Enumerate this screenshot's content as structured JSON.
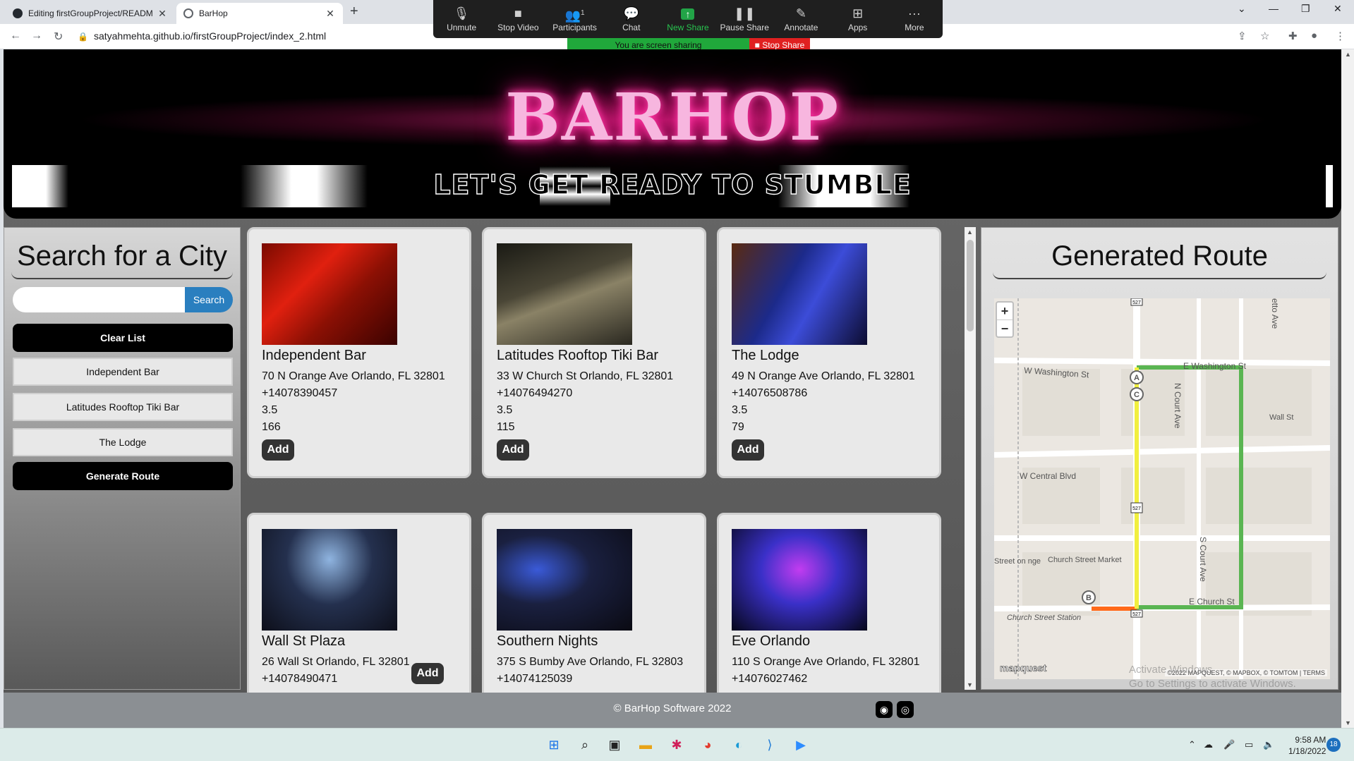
{
  "browser": {
    "tabs": [
      {
        "title": "Editing firstGroupProject/READM",
        "active": false
      },
      {
        "title": "BarHop",
        "active": true
      }
    ],
    "new_tab": "+",
    "url": "satyahmehta.github.io/firstGroupProject/index_2.html"
  },
  "zoom": {
    "buttons": [
      {
        "label": "Unmute",
        "icon": "mic-off-icon"
      },
      {
        "label": "Stop Video",
        "icon": "video-camera-icon"
      },
      {
        "label": "Participants",
        "icon": "participants-icon",
        "count": "1"
      },
      {
        "label": "Chat",
        "icon": "chat-icon"
      },
      {
        "label": "New Share",
        "icon": "share-arrow-icon"
      },
      {
        "label": "Pause Share",
        "icon": "pause-icon"
      },
      {
        "label": "Annotate",
        "icon": "pencil-icon"
      },
      {
        "label": "Apps",
        "icon": "apps-icon"
      },
      {
        "label": "More",
        "icon": "ellipsis-icon"
      }
    ],
    "sharing_text": "You are screen sharing",
    "stop_share": "Stop Share"
  },
  "hero": {
    "brand": "BARHOP",
    "tagline": "LET'S GET READY TO STUMBLE"
  },
  "sidebar": {
    "title": "Search for a City",
    "search_placeholder": "",
    "search_button": "Search",
    "clear_button": "Clear List",
    "list": [
      "Independent Bar",
      "Latitudes Rooftop Tiki Bar",
      "The Lodge"
    ],
    "generate_button": "Generate Route"
  },
  "cards": [
    {
      "name": "Independent Bar",
      "address": "70 N Orange Ave Orlando, FL 32801",
      "phone": "+14078390457",
      "rating": "3.5",
      "reviews": "166",
      "add": "Add"
    },
    {
      "name": "Latitudes Rooftop Tiki Bar",
      "address": "33 W Church St Orlando, FL 32801",
      "phone": "+14076494270",
      "rating": "3.5",
      "reviews": "115",
      "add": "Add"
    },
    {
      "name": "The Lodge",
      "address": "49 N Orange Ave Orlando, FL 32801",
      "phone": "+14076508786",
      "rating": "3.5",
      "reviews": "79",
      "add": "Add"
    },
    {
      "name": "Wall St Plaza",
      "address": "26 Wall St Orlando, FL 32801",
      "phone": "+14078490471",
      "add": "Add"
    },
    {
      "name": "Southern Nights",
      "address": "375 S Bumby Ave Orlando, FL 32803",
      "phone": "+14074125039"
    },
    {
      "name": "Eve Orlando",
      "address": "110 S Orange Ave Orlando, FL 32801",
      "phone": "+14076027462"
    }
  ],
  "route": {
    "title": "Generated Route",
    "zoom_in": "+",
    "zoom_out": "−",
    "streets": {
      "washington_w": "W Washington St",
      "washington_e": "E Washington St",
      "wall": "Wall St",
      "central": "W Central Blvd",
      "n_court": "N Court Ave",
      "s_court": "S Court Ave",
      "church_e": "E Church St",
      "setto": "etto Ave",
      "market": "Church Street Market",
      "station": "Church Street Station",
      "street_partial": "Street on nge"
    },
    "shields": [
      "527",
      "527",
      "527"
    ],
    "markers": [
      "A",
      "C",
      "B"
    ],
    "logo": "mapquest",
    "attribution": "©2022 MAPQUEST, © MAPBOX, © TOMTOM | TERMS"
  },
  "windows_watermark": {
    "line1": "Activate Windows",
    "line2": "Go to Settings to activate Windows."
  },
  "footer": {
    "copyright": "© BarHop Software 2022"
  },
  "taskbar": {
    "time": "9:58 AM",
    "date": "1/18/2022",
    "notifications": "18"
  },
  "colors": {
    "route_yellow": "#f1ef3f",
    "route_green": "#5ab552",
    "route_orange": "#ff6a1a",
    "search_blue": "#2a7fbf",
    "brand_pink": "#f7b6df"
  }
}
